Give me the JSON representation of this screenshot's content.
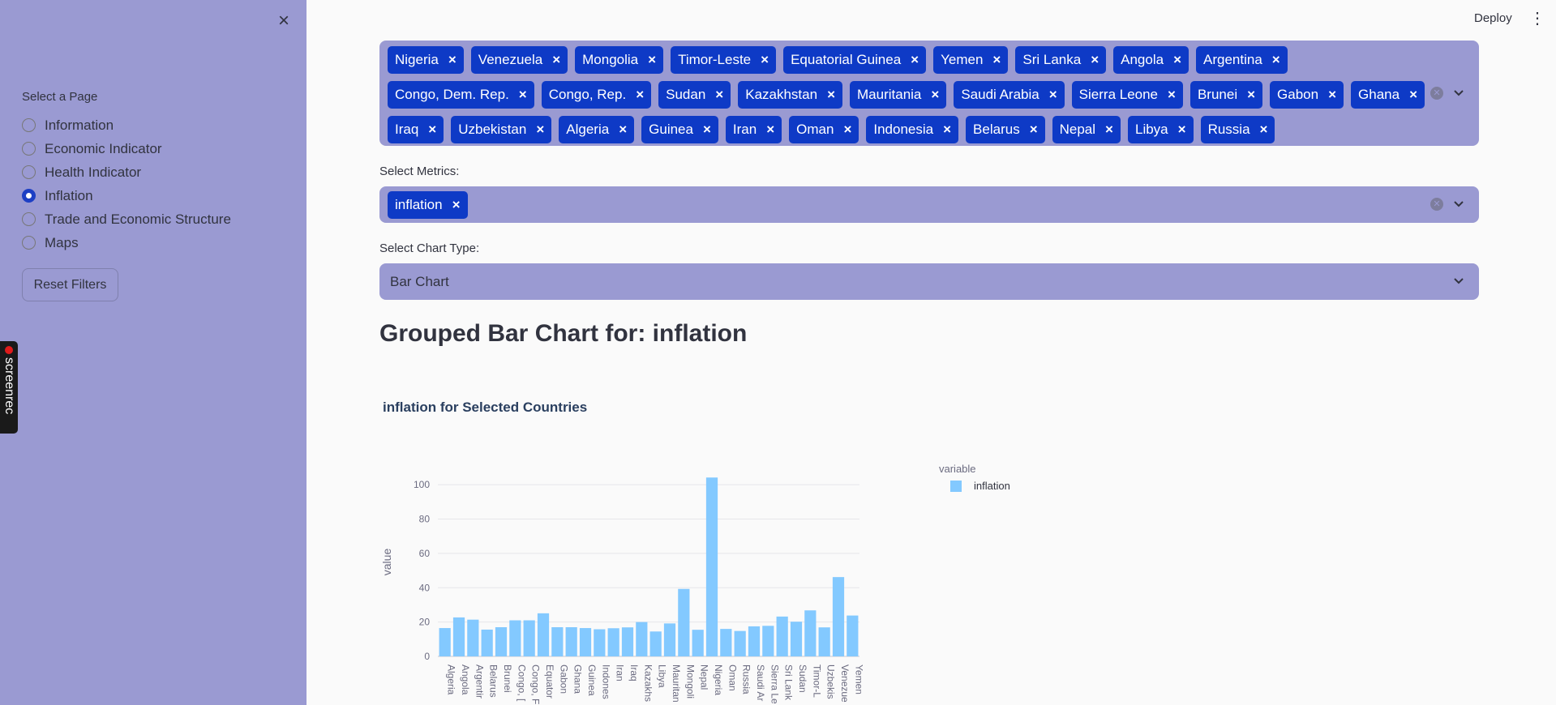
{
  "sidebar": {
    "close_label": "×",
    "page_label": "Select a Page",
    "pages": [
      {
        "label": "Information",
        "selected": false
      },
      {
        "label": "Economic Indicator",
        "selected": false
      },
      {
        "label": "Health Indicator",
        "selected": false
      },
      {
        "label": "Inflation",
        "selected": true
      },
      {
        "label": "Trade and Economic Structure",
        "selected": false
      },
      {
        "label": "Maps",
        "selected": false
      }
    ],
    "reset_label": "Reset Filters"
  },
  "screenrec": {
    "label": "screenrec"
  },
  "header": {
    "deploy_label": "Deploy",
    "menu_label": "⋮"
  },
  "countries": [
    "Nigeria",
    "Venezuela",
    "Mongolia",
    "Timor-Leste",
    "Equatorial Guinea",
    "Yemen",
    "Sri Lanka",
    "Angola",
    "Argentina",
    "Congo, Dem. Rep.",
    "Congo, Rep.",
    "Sudan",
    "Kazakhstan",
    "Mauritania",
    "Saudi Arabia",
    "Sierra Leone",
    "Brunei",
    "Gabon",
    "Ghana",
    "Iraq",
    "Uzbekistan",
    "Algeria",
    "Guinea",
    "Iran",
    "Oman",
    "Indonesia",
    "Belarus",
    "Nepal",
    "Libya",
    "Russia"
  ],
  "metrics": {
    "label": "Select Metrics:",
    "selected": [
      "inflation"
    ]
  },
  "chart_type": {
    "label": "Select Chart Type:",
    "value": "Bar Chart"
  },
  "heading": "Grouped Bar Chart for: inflation",
  "chart_data": {
    "type": "bar",
    "title": "inflation  for Selected Countries",
    "xlabel": "",
    "ylabel": "value",
    "ylim": [
      0,
      110
    ],
    "yticks": [
      0,
      20,
      40,
      60,
      80,
      100
    ],
    "grid": true,
    "legend": {
      "title": "variable",
      "placement": "right"
    },
    "categories": [
      "Algeria",
      "Angola",
      "Argentina",
      "Belarus",
      "Brunei",
      "Congo, Dem. Rep.",
      "Congo, Rep.",
      "Equatorial Guinea",
      "Gabon",
      "Ghana",
      "Guinea",
      "Indonesia",
      "Iran",
      "Iraq",
      "Kazakhstan",
      "Libya",
      "Mauritania",
      "Mongolia",
      "Nepal",
      "Nigeria",
      "Oman",
      "Russia",
      "Saudi Arabia",
      "Sierra Leone",
      "Sri Lanka",
      "Sudan",
      "Timor-Leste",
      "Uzbekistan",
      "Venezuela",
      "Yemen"
    ],
    "tick_labels": [
      "Algeria",
      "Angola",
      "Argentir",
      "Belarus",
      "Brunei",
      "Congo, [",
      "Congo, F",
      "Equator",
      "Gabon",
      "Ghana",
      "Guinea",
      "Indones",
      "Iran",
      "Iraq",
      "Kazakhs",
      "Libya",
      "Mauritan",
      "Mongoli",
      "Nepal",
      "Nigeria",
      "Oman",
      "Russia",
      "Saudi Ar",
      "Sierra Le",
      "Sri Lank",
      "Sudan",
      "Timor-L",
      "Uzbekis",
      "Venezue",
      "Yemen"
    ],
    "series": [
      {
        "name": "inflation",
        "color": "#83c9ff",
        "values": [
          16.5,
          22.7,
          21.4,
          15.6,
          17.0,
          21.0,
          21.0,
          25.1,
          17.0,
          17.0,
          16.5,
          15.8,
          16.4,
          16.9,
          20.0,
          14.5,
          19.2,
          39.3,
          15.5,
          104.2,
          16.0,
          14.8,
          17.5,
          17.8,
          23.2,
          20.2,
          26.8,
          16.9,
          46.2,
          23.8
        ]
      }
    ]
  }
}
